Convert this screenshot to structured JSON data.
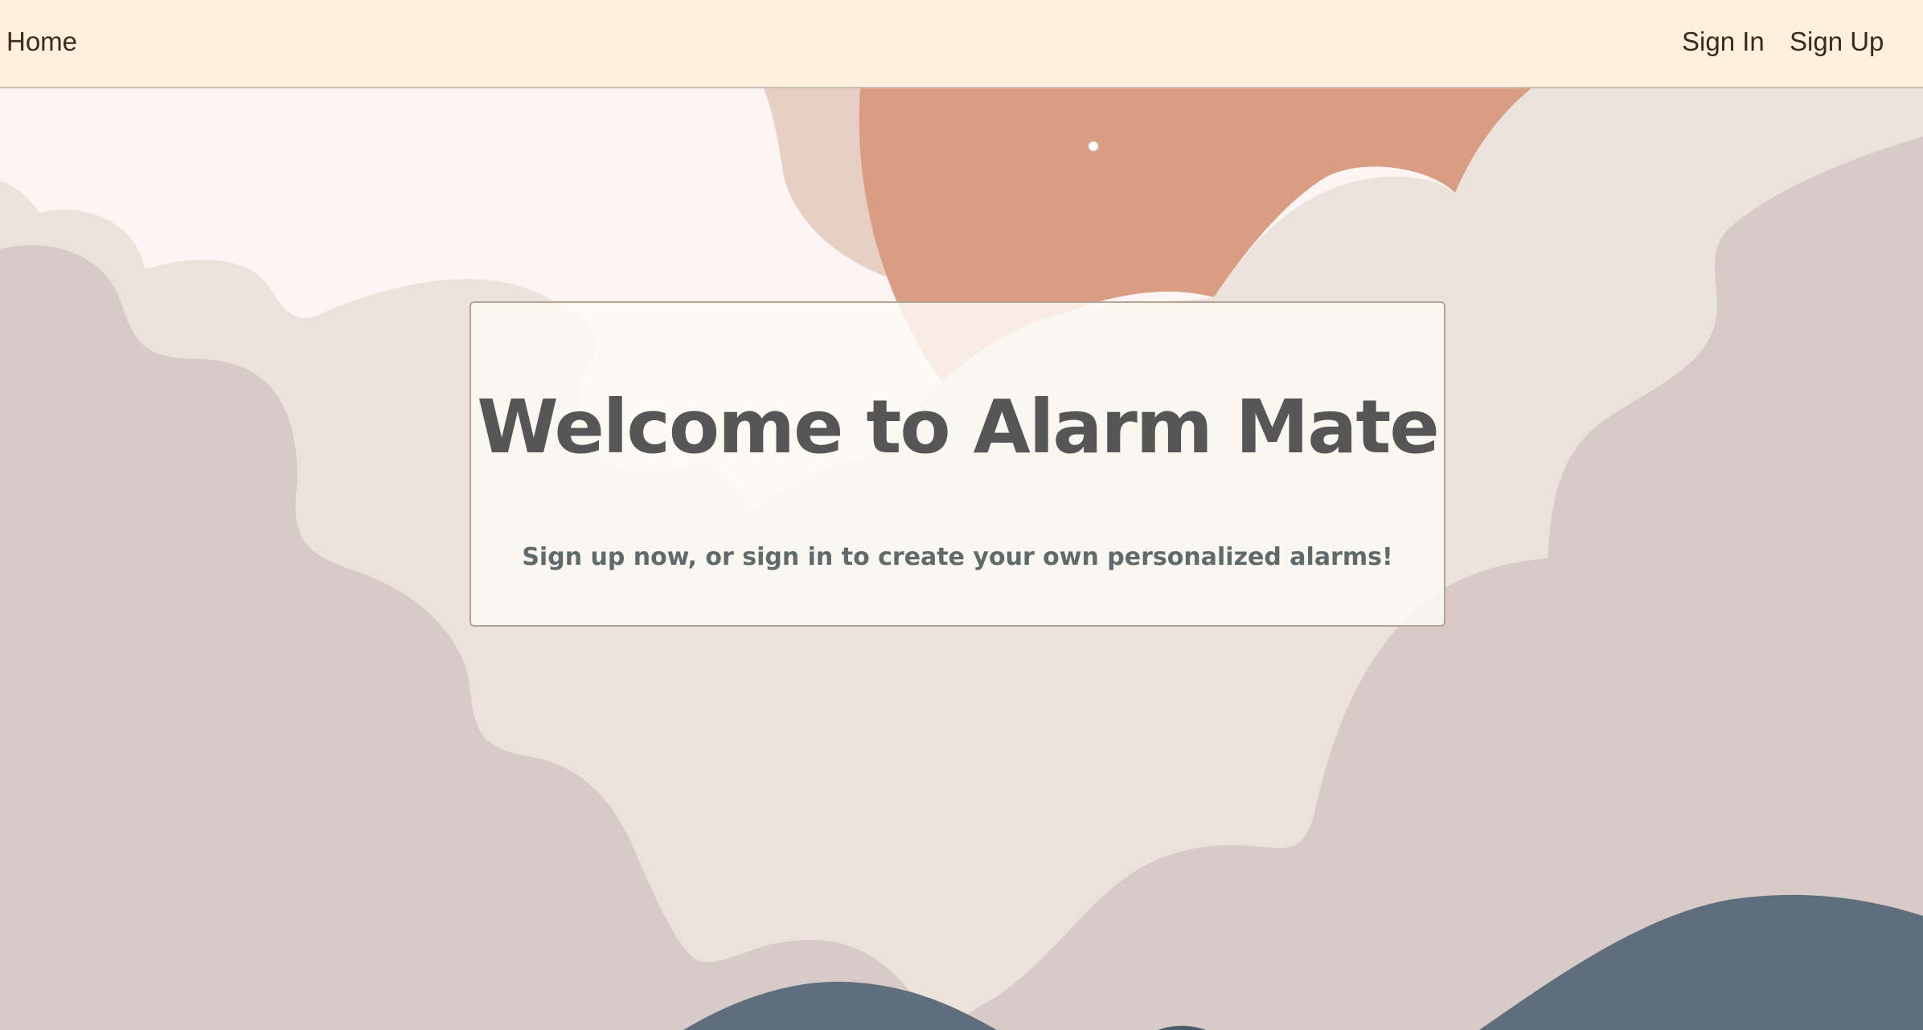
{
  "nav": {
    "home_label": "Home",
    "sign_in_label": "Sign In",
    "sign_up_label": "Sign Up"
  },
  "hero": {
    "title": "Welcome to Alarm Mate",
    "subtitle": "Sign up now, or sign in to create your own personalized alarms!"
  },
  "colors": {
    "navbar_bg": "#fdf1dd",
    "sky": "#fdf5f3",
    "sun": "#d99d84",
    "sun_glow": "#e8cfc3",
    "cloud_light": "#ebe3db",
    "cloud_mauve": "#d8cac7",
    "mountain": "#5f6e7c",
    "title_text": "#575656",
    "subtitle_text": "#5f6b6a"
  }
}
